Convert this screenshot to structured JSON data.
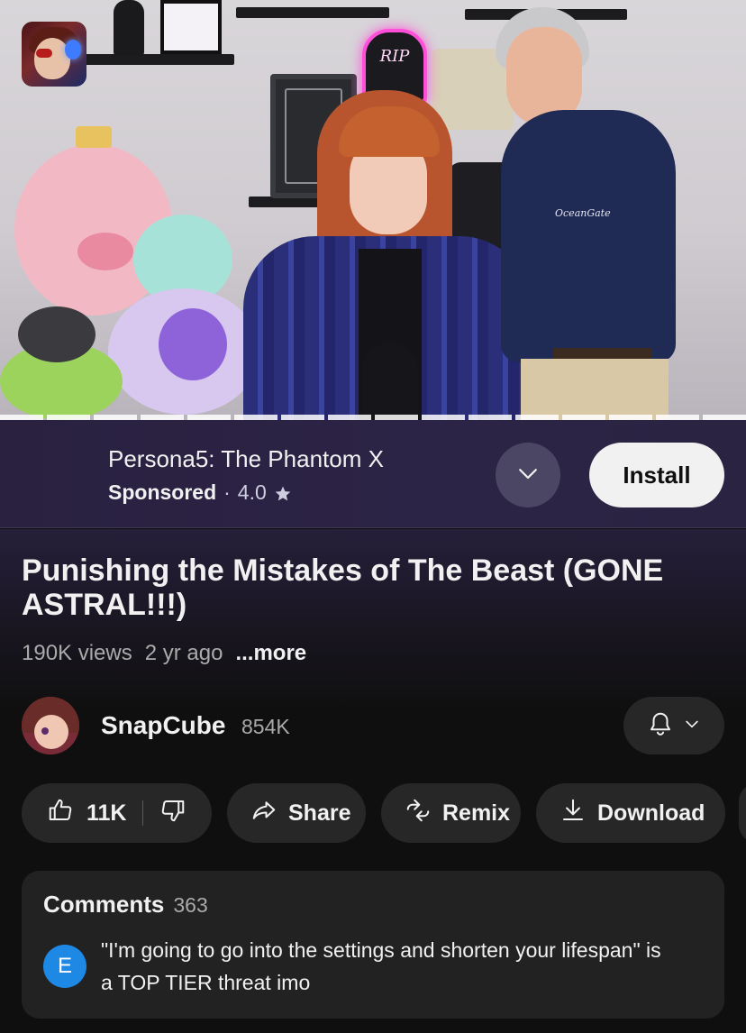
{
  "video": {
    "scene_signs": {
      "rip_sign": "RIP",
      "shirt_logo": "OceanGate"
    },
    "playback_progress_fraction": 1.0
  },
  "ad": {
    "app_name": "Persona5: The Phantom X",
    "sponsored_label": "Sponsored",
    "separator": "·",
    "rating": "4.0",
    "rating_icon": "star-icon",
    "expand_icon": "chevron-down-icon",
    "install_label": "Install"
  },
  "video_info": {
    "title": "Punishing the Mistakes of The Beast (GONE ASTRAL!!!)",
    "views": "190K views",
    "age": "2 yr ago",
    "more_label": "...more"
  },
  "channel": {
    "name": "SnapCube",
    "subscribers": "854K",
    "notification_icon": "bell-icon"
  },
  "actions": {
    "like_count": "11K",
    "share_label": "Share",
    "remix_label": "Remix",
    "download_label": "Download"
  },
  "comments": {
    "label": "Comments",
    "count": "363",
    "top_comment": {
      "author_initial": "E",
      "avatar_color": "#1e88e5",
      "text": "\"I'm going to go into the settings and shorten your lifespan\" is a TOP TIER threat imo"
    }
  },
  "colors": {
    "background": "#0f0f0f",
    "ad_background": "#2a2140",
    "pill_background": "#272727",
    "install_button": "#f1f1f1"
  }
}
